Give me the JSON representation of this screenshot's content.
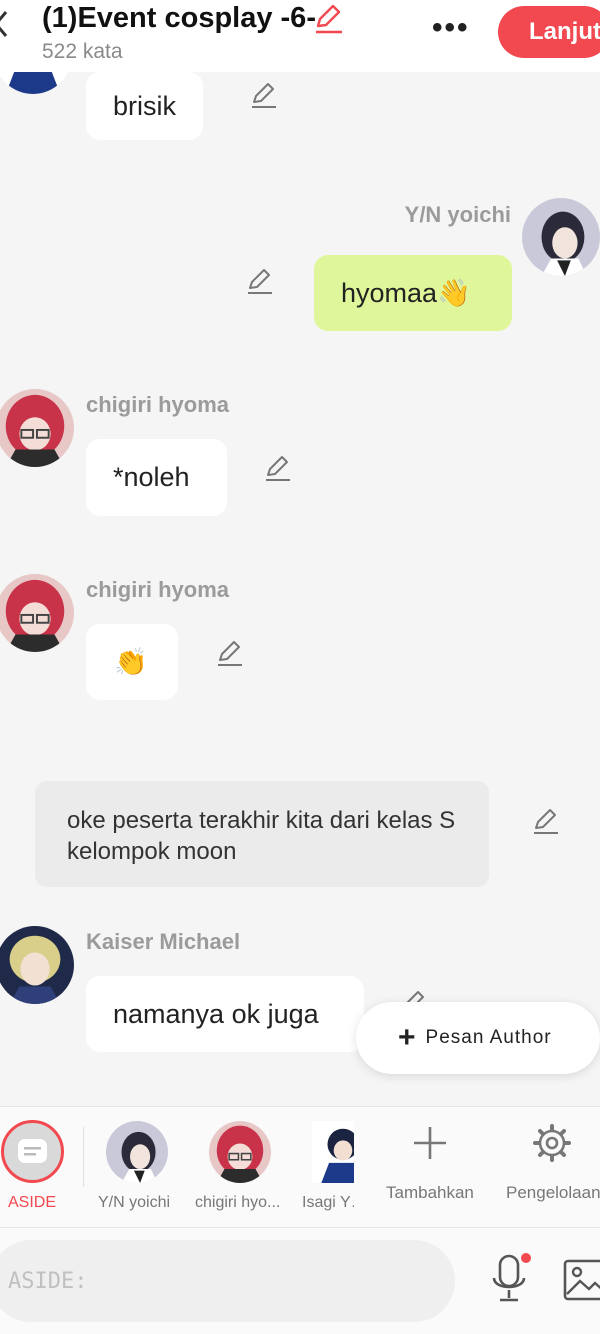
{
  "header": {
    "title": "(1)Event cosplay -6-",
    "word_count": "522 kata",
    "more": "•••",
    "next_button": "Lanjut"
  },
  "chat": {
    "msg1": {
      "text": "brisik"
    },
    "msg2": {
      "name": "Y/N yoichi",
      "text": "hyomaa👋"
    },
    "msg3": {
      "name": "chigiri hyoma",
      "text": "*noleh"
    },
    "msg4": {
      "name": "chigiri hyoma",
      "text": "👏"
    },
    "aside": {
      "text": "oke peserta terakhir kita dari kelas S kelompok moon"
    },
    "msg5": {
      "name": "Kaiser Michael",
      "text": "namanya ok juga"
    }
  },
  "author_button": {
    "label": "Pesan Author"
  },
  "characters": [
    {
      "label": "ASIDE"
    },
    {
      "label": "Y/N yoichi"
    },
    {
      "label": "chigiri hyo..."
    },
    {
      "label": "Isagi Y…"
    },
    {
      "label": "Tambahkan"
    },
    {
      "label": "Pengelolaan"
    }
  ],
  "input": {
    "placeholder": "ASIDE:"
  },
  "colors": {
    "accent": "#f2484f",
    "mine_bubble": "#dff79a",
    "aside_bubble": "#ebebeb"
  }
}
